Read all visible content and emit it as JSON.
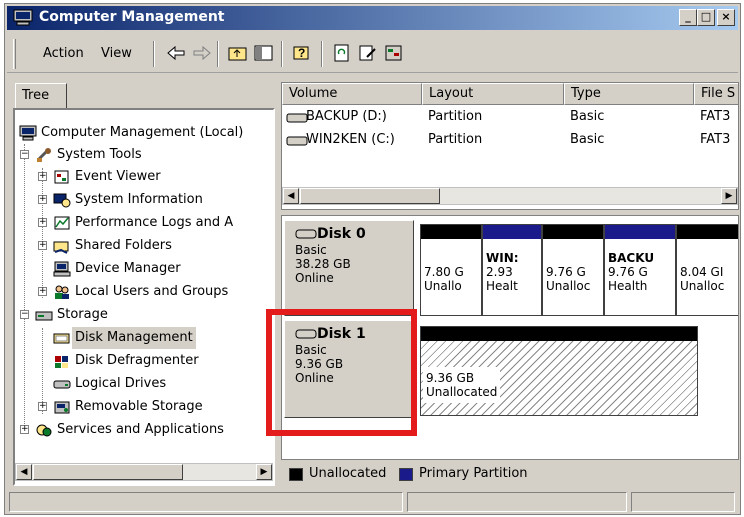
{
  "window": {
    "title": "Computer Management"
  },
  "menu": {
    "action": "Action",
    "view": "View"
  },
  "tree": {
    "tab_label": "Tree",
    "root": "Computer Management (Local)",
    "system_tools": "System Tools",
    "event_viewer": "Event Viewer",
    "system_information": "System Information",
    "performance_logs": "Performance Logs and A",
    "shared_folders": "Shared Folders",
    "device_manager": "Device Manager",
    "local_users": "Local Users and Groups",
    "storage": "Storage",
    "disk_management": "Disk Management",
    "disk_defragmenter": "Disk Defragmenter",
    "logical_drives": "Logical Drives",
    "removable_storage": "Removable Storage",
    "services": "Services and Applications"
  },
  "volumes": {
    "columns": [
      "Volume",
      "Layout",
      "Type",
      "File S"
    ],
    "rows": [
      {
        "volume": "BACKUP (D:)",
        "layout": "Partition",
        "type": "Basic",
        "fs": "FAT3"
      },
      {
        "volume": "WIN2KEN (C:)",
        "layout": "Partition",
        "type": "Basic",
        "fs": "FAT3"
      }
    ]
  },
  "disks": [
    {
      "name": "Disk 0",
      "kind": "Basic",
      "size": "38.28 GB",
      "status": "Online",
      "partitions": [
        {
          "name": "",
          "size": "7.80 G",
          "state": "Unallo",
          "color": "#000000"
        },
        {
          "name": "WIN:",
          "size": "2.93",
          "state": "Healt",
          "color": "#1a1a8a"
        },
        {
          "name": "",
          "size": "9.76 G",
          "state": "Unalloc",
          "color": "#000000"
        },
        {
          "name": "BACKU",
          "size": "9.76 G",
          "state": "Health",
          "color": "#1a1a8a"
        },
        {
          "name": "",
          "size": "8.04 GI",
          "state": "Unalloc",
          "color": "#000000"
        }
      ]
    },
    {
      "name": "Disk 1",
      "kind": "Basic",
      "size": "9.36 GB",
      "status": "Online",
      "partitions": [
        {
          "name": "",
          "size": "9.36 GB",
          "state": "Unallocated",
          "color": "#000000"
        }
      ]
    }
  ],
  "legend": {
    "unallocated": "Unallocated",
    "unallocated_color": "#000000",
    "primary": "Primary Partition",
    "primary_color": "#1a1a8a"
  },
  "highlight_color": "#e31b1b"
}
